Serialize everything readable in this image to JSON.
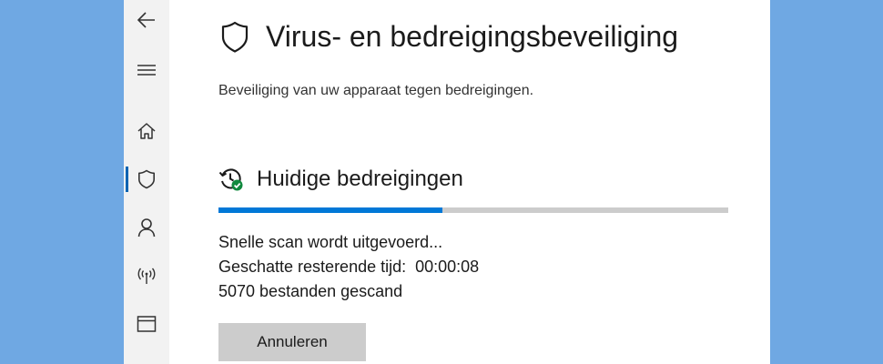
{
  "page": {
    "title": "Virus- en bedreigingsbeveiliging",
    "subtitle": "Beveiliging van uw apparaat tegen bedreigingen."
  },
  "sidebar": {
    "items": [
      {
        "icon": "back-arrow-icon"
      },
      {
        "icon": "hamburger-menu-icon"
      },
      {
        "icon": "home-icon"
      },
      {
        "icon": "shield-icon",
        "active": true
      },
      {
        "icon": "person-icon"
      },
      {
        "icon": "wireless-icon"
      },
      {
        "icon": "app-browser-icon"
      }
    ]
  },
  "threats": {
    "heading": "Huidige bedreigingen",
    "progress_fraction": 0.44,
    "status": "Snelle scan wordt uitgevoerd...",
    "remaining_time": "Geschatte resterende tijd:  00:00:08",
    "files_scanned": "5070 bestanden gescand",
    "cancel_label": "Annuleren"
  },
  "colors": {
    "accent": "#0078d7",
    "desktop_background": "#6fa8e3",
    "sidebar_background": "#f2f2f2",
    "check_badge": "#10893e"
  }
}
